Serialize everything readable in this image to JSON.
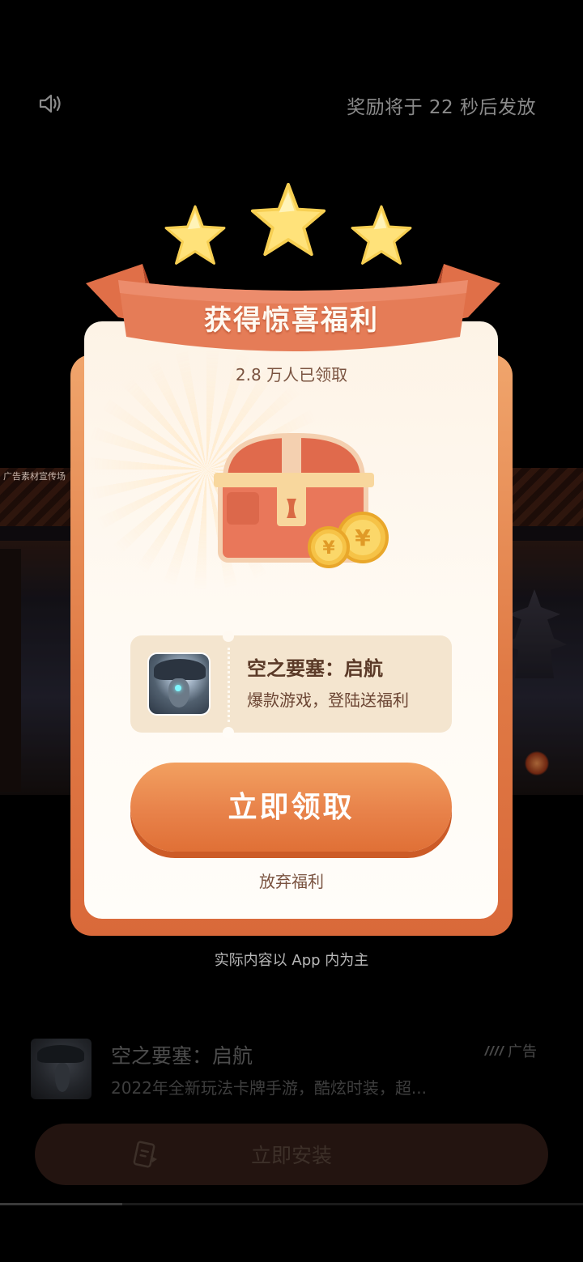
{
  "topbar": {
    "countdown_text": "奖励将于 22 秒后发放",
    "sound_icon": "speaker-icon"
  },
  "background": {
    "ad_watermark": "广告素材宣传场"
  },
  "reward_card": {
    "title": "获得惊喜福利",
    "claimed_count": "2.8 万人已领取",
    "stars": 3,
    "chest_icon": "treasure-chest-icon",
    "coin_symbol": "¥",
    "game": {
      "name": "空之要塞：启航",
      "description": "爆款游戏，登陆送福利"
    },
    "claim_button": "立即领取",
    "give_up_link": "放弃福利"
  },
  "disclaimer": "实际内容以 App 内为主",
  "bottom_ad": {
    "title": "空之要塞：启航",
    "description": "2022年全新玩法卡牌手游，酷炫时装，超...",
    "ad_label": "广告",
    "install_button": "立即安装"
  },
  "video_progress": 0.21,
  "colors": {
    "accent": "#e8824a",
    "card_bg": "#fdf3e6",
    "title_text": "#5b3a28"
  }
}
